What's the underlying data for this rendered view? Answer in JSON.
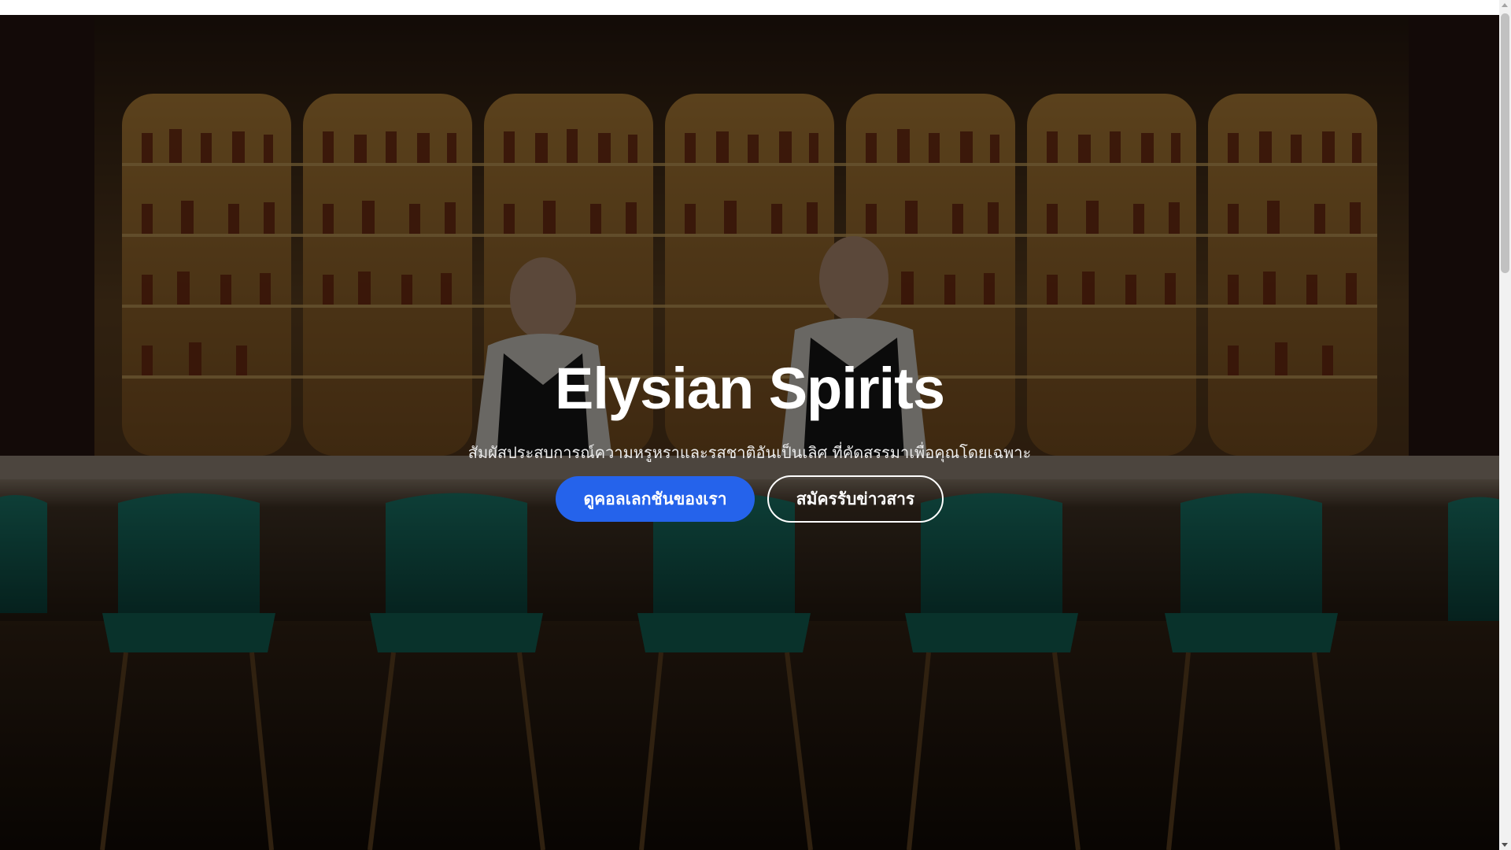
{
  "hero": {
    "title": "Elysian Spirits",
    "subtitle": "สัมผัสประสบการณ์ความหรูหราและรสชาติอันเป็นเลิศ ที่คัดสรรมาเพื่อคุณโดยเฉพาะ",
    "primary_button": "ดูคอลเลกชันของเรา",
    "secondary_button": "สมัครรับข่าวสาร",
    "background_image": "luxury-bar-with-bartenders-and-bottle-shelves"
  },
  "colors": {
    "primary_button": "#2563eb",
    "text": "#ffffff",
    "overlay": "rgba(0,0,0,0.55)"
  }
}
